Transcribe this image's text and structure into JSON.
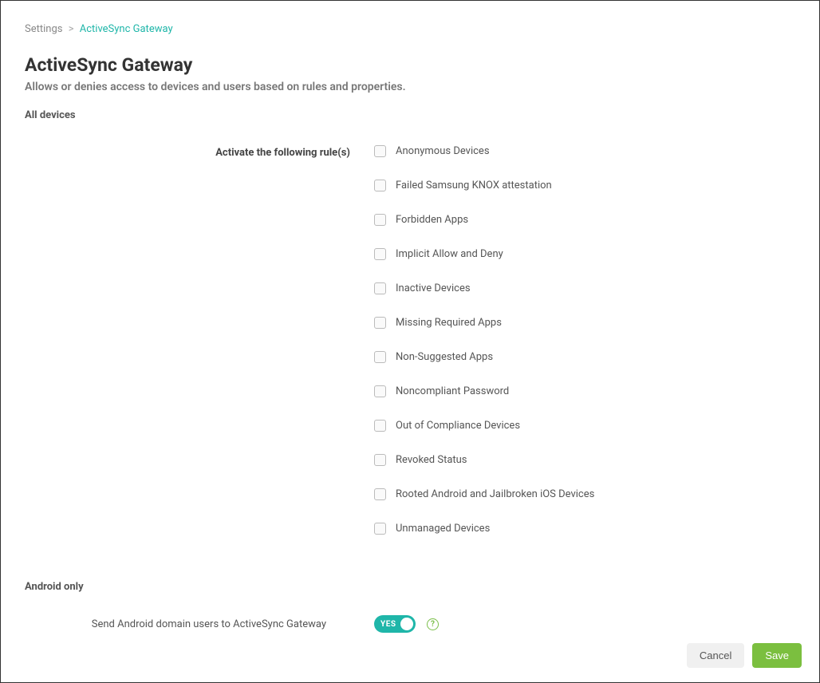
{
  "breadcrumb": {
    "root": "Settings",
    "current": "ActiveSync Gateway"
  },
  "page": {
    "title": "ActiveSync Gateway",
    "subtitle": "Allows or denies access to devices and users based on rules and properties."
  },
  "sections": {
    "all_devices_label": "All devices",
    "activate_label": "Activate the following rule(s)",
    "android_only_label": "Android only",
    "android_toggle_label": "Send Android domain users to ActiveSync Gateway"
  },
  "rules": [
    {
      "label": "Anonymous Devices",
      "checked": false
    },
    {
      "label": "Failed Samsung KNOX attestation",
      "checked": false
    },
    {
      "label": "Forbidden Apps",
      "checked": false
    },
    {
      "label": "Implicit Allow and Deny",
      "checked": false
    },
    {
      "label": "Inactive Devices",
      "checked": false
    },
    {
      "label": "Missing Required Apps",
      "checked": false
    },
    {
      "label": "Non-Suggested Apps",
      "checked": false
    },
    {
      "label": "Noncompliant Password",
      "checked": false
    },
    {
      "label": "Out of Compliance Devices",
      "checked": false
    },
    {
      "label": "Revoked Status",
      "checked": false
    },
    {
      "label": "Rooted Android and Jailbroken iOS Devices",
      "checked": false
    },
    {
      "label": "Unmanaged Devices",
      "checked": false
    }
  ],
  "toggle": {
    "state": "YES",
    "enabled": true
  },
  "buttons": {
    "cancel": "Cancel",
    "save": "Save"
  },
  "colors": {
    "accent_teal": "#1fb6a9",
    "accent_green": "#7bbf3f"
  }
}
